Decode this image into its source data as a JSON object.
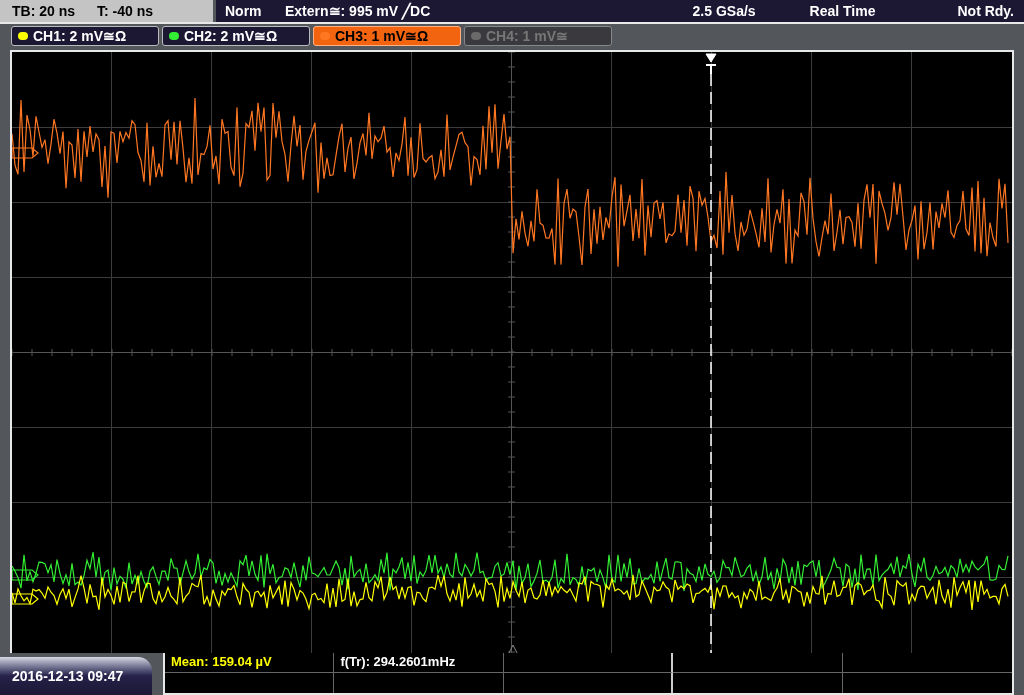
{
  "status_bar": {
    "timebase": "TB: 20 ns",
    "trigger_time": "T: -40 ns",
    "mode": "Norm",
    "trigger_source": "Extern≅: 995 mV ╱DC",
    "sample_rate": "2.5 GSa/s",
    "acquisition": "Real Time",
    "state": "Not Rdy."
  },
  "channels": [
    {
      "label": "CH1: 2 mV≅Ω",
      "color": "#ffff00",
      "selected": false,
      "disabled": false
    },
    {
      "label": "CH2: 2 mV≅Ω",
      "color": "#33ee33",
      "selected": false,
      "disabled": false
    },
    {
      "label": "CH3: 1 mV≅Ω",
      "color": "#ff7722",
      "selected": true,
      "disabled": false
    },
    {
      "label": "CH4: 1 mV≅",
      "color": "#6a6a6a",
      "selected": false,
      "disabled": true
    }
  ],
  "measurements": [
    {
      "label": "Mean: 159.04 µV",
      "color": "#ffff00"
    },
    {
      "label": "f(Tr): 294.2601mHz",
      "color": "#ffffff"
    }
  ],
  "date_time": "2016-12-13 09:47"
}
